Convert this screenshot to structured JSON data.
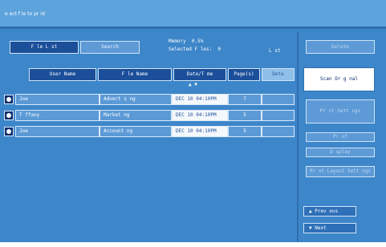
{
  "title": "e ect f le to pr nt",
  "tabs": [
    {
      "label": "F le L st",
      "active": true
    },
    {
      "label": "Search",
      "active": false
    }
  ],
  "memory": {
    "label": "Memory",
    "value": "0.5%"
  },
  "selected_files": {
    "label": "Selected F les:",
    "value": "0"
  },
  "list_label": "L st",
  "columns": [
    "User Name",
    "F le Name",
    "Date/T me",
    "Page(s)",
    "Deta"
  ],
  "sort_indicator": "▲ ▼",
  "rows": [
    {
      "user": "Joe",
      "file": "Advert s ng",
      "datetime": "DEC 10 04:10PM",
      "pages": "7"
    },
    {
      "user": "T ffany",
      "file": "Market ng",
      "datetime": "DEC 10 04:10PM",
      "pages": "5"
    },
    {
      "user": "Joe",
      "file": "Account ng",
      "datetime": "DEC 10 04:10PM",
      "pages": "5"
    }
  ],
  "side_buttons": {
    "delete": "Delete",
    "scan_original": "Scan Or g nal",
    "print_settings": "Pr nt Sett ngs",
    "print": "Pr nt",
    "display": "D splay",
    "print_layout_settings": "Pr nt Layout Sett ngs",
    "previous": "▲ Prev ous",
    "next": "▼ Next"
  }
}
